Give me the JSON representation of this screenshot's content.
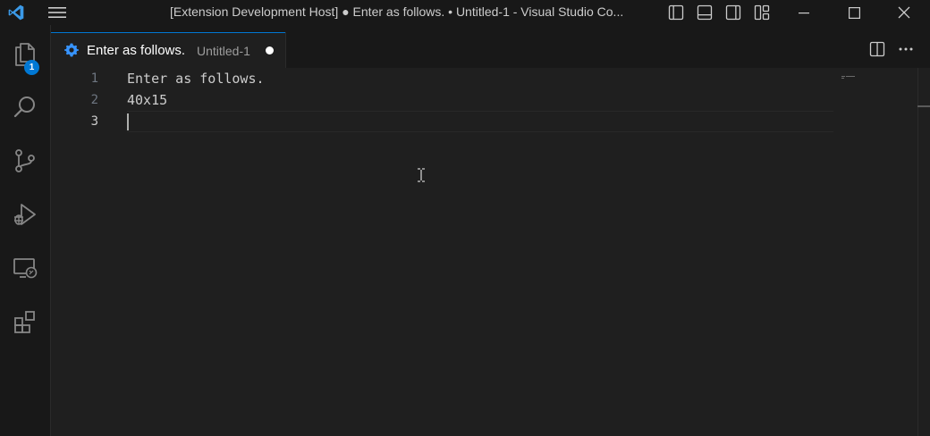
{
  "titlebar": {
    "title": "[Extension Development Host] ● Enter as follows. • Untitled-1 - Visual Studio Co...",
    "icons": [
      "vscode-logo-icon",
      "menu-icon",
      "toggle-primary-sidebar-icon",
      "toggle-panel-icon",
      "toggle-secondary-sidebar-icon",
      "customize-layout-icon",
      "minimize-icon",
      "maximize-icon",
      "close-icon"
    ]
  },
  "activitybar": {
    "items": [
      {
        "name": "explorer",
        "icon": "files-icon",
        "badge": "1"
      },
      {
        "name": "search",
        "icon": "search-icon"
      },
      {
        "name": "source-control",
        "icon": "source-control-icon"
      },
      {
        "name": "run-and-debug",
        "icon": "debug-icon"
      },
      {
        "name": "remote-explorer",
        "icon": "remote-explorer-icon"
      },
      {
        "name": "extensions",
        "icon": "extensions-icon"
      }
    ]
  },
  "tab": {
    "label": "Enter as follows.",
    "description": "Untitled-1",
    "icon": "gear-icon",
    "dirty": true
  },
  "editor_actions": [
    "split-editor-icon",
    "more-actions-icon"
  ],
  "editor": {
    "lines": [
      {
        "number": "1",
        "text": "Enter as follows."
      },
      {
        "number": "2",
        "text": "40x15"
      },
      {
        "number": "3",
        "text": ""
      }
    ],
    "active_line": 3
  },
  "colors": {
    "accent": "#0078d4",
    "background": "#1f1f1f",
    "chrome": "#181818",
    "text": "#cccccc"
  }
}
